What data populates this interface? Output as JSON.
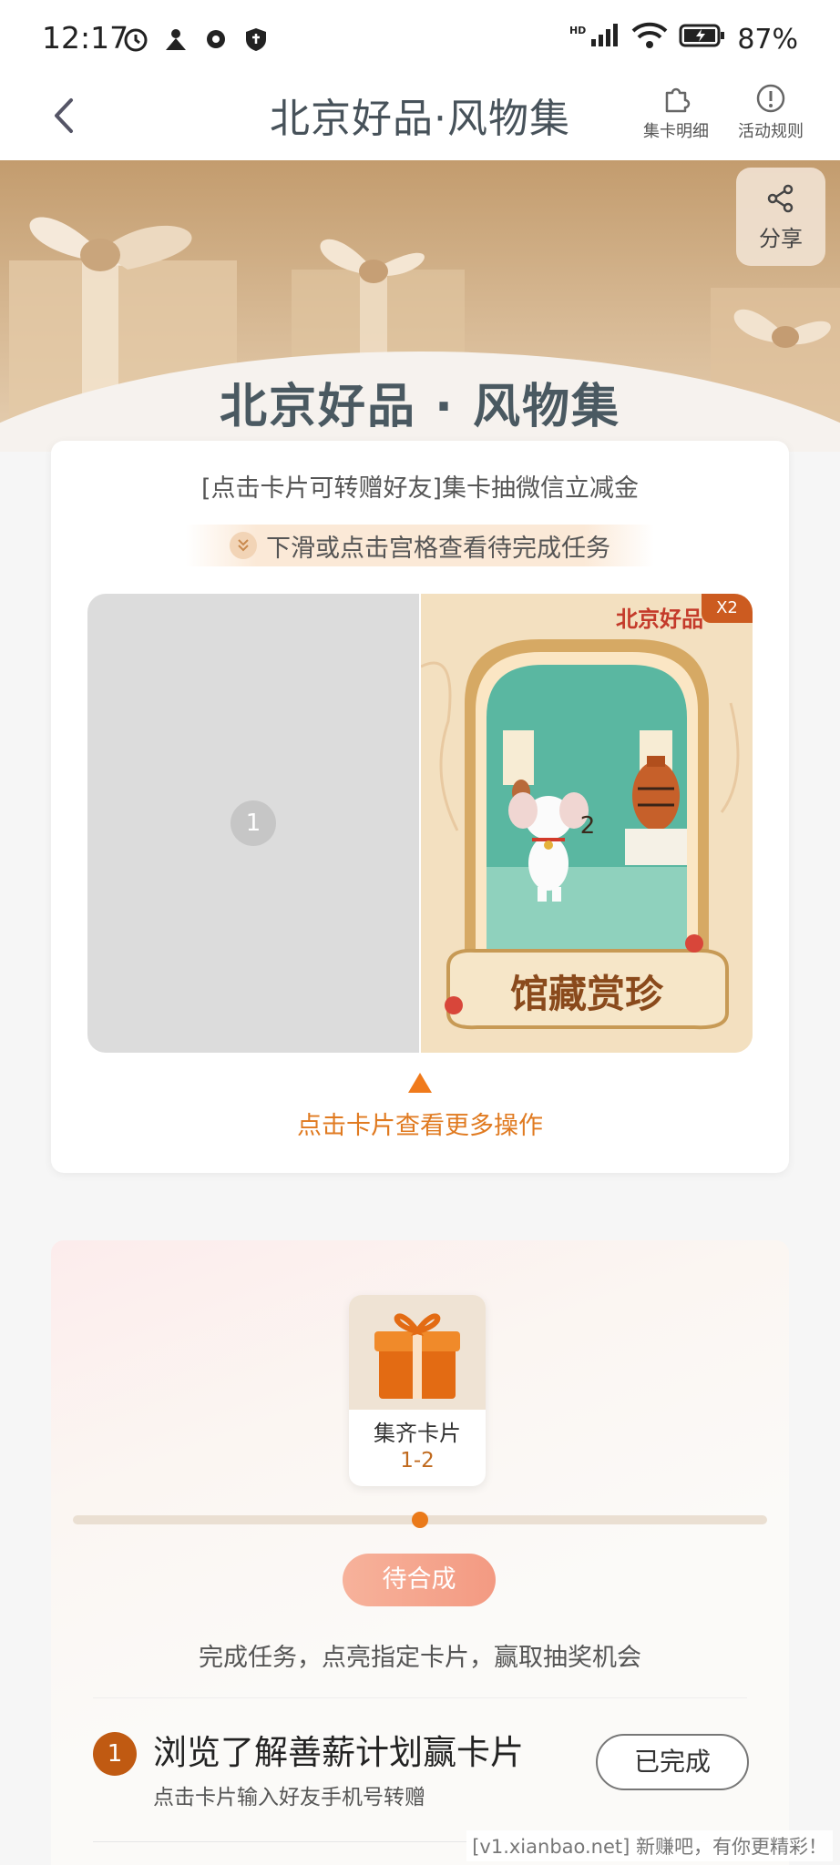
{
  "status_bar": {
    "time": "12:17",
    "battery": "87%",
    "network": "HD"
  },
  "nav": {
    "title": "北京好品·风物集",
    "card_detail_label": "集卡明细",
    "rules_label": "活动规则"
  },
  "banner": {
    "title": "北京好品 · 风物集",
    "share_label": "分享"
  },
  "card_panel": {
    "subtitle": "[点击卡片可转赠好友]集卡抽微信立减金",
    "hint": "下滑或点击宫格查看待完成任务",
    "cards": [
      {
        "number": "1",
        "collected": false
      },
      {
        "number": "2",
        "collected": true,
        "count_badge": "X2",
        "brand_text": "北京好品",
        "card_name": "馆藏赏珍"
      }
    ],
    "more_actions": "点击卡片查看更多操作"
  },
  "reward": {
    "gift_label": "集齐卡片",
    "gift_range": "1-2",
    "progress": 0.5,
    "status_button": "待合成",
    "description": "完成任务，点亮指定卡片，赢取抽奖机会",
    "tasks": [
      {
        "number": "1",
        "title": "浏览了解善薪计划赢卡片",
        "subtitle": "点击卡片输入好友手机号转赠",
        "action": "已完成"
      }
    ]
  },
  "watermark": "[v1.xianbao.net] 新赚吧，有你更精彩！",
  "colors": {
    "accent": "#e07a20",
    "badge": "#cc5b20",
    "title": "#4a5961"
  }
}
